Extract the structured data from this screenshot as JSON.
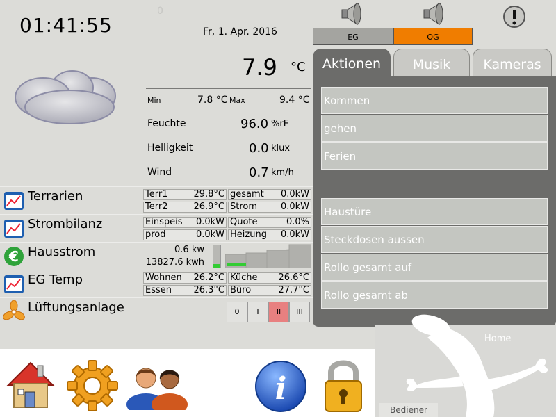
{
  "header": {
    "clock": "01:41:55",
    "date": "Fr, 1. Apr. 2016",
    "small_indicator": "0"
  },
  "weather": {
    "icon": "cloud-icon",
    "temperature": "7.9",
    "temperature_unit": "°C",
    "min_label": "Min",
    "min_value": "7.8 °C",
    "max_label": "Max",
    "max_value": "9.4 °C",
    "humidity_label": "Feuchte",
    "humidity_value": "96.0",
    "humidity_unit": "%rF",
    "brightness_label": "Helligkeit",
    "brightness_value": "0.0",
    "brightness_unit": "klux",
    "wind_label": "Wind",
    "wind_value": "0.7",
    "wind_unit": "km/h"
  },
  "sidebar": {
    "items": [
      {
        "label": "Terrarien",
        "icon": "chart-icon"
      },
      {
        "label": "Strombilanz",
        "icon": "chart-icon"
      },
      {
        "label": "Hausstrom",
        "icon": "euro-icon"
      },
      {
        "label": "EG Temp",
        "icon": "chart-icon"
      },
      {
        "label": "Lüftungsanlage",
        "icon": "fan-icon"
      }
    ]
  },
  "terrarien": {
    "terr1_label": "Terr1",
    "terr1_value": "29.8°C",
    "terr2_label": "Terr2",
    "terr2_value": "26.9°C",
    "gesamt_label": "gesamt",
    "gesamt_value": "0.0kW",
    "strom_label": "Strom",
    "strom_value": "0.0kW"
  },
  "strombilanz": {
    "einspeis_label": "Einspeis",
    "einspeis_value": "0.0kW",
    "prod_label": "prod",
    "prod_value": "0.0kW",
    "quote_label": "Quote",
    "quote_value": "0.0%",
    "heizung_label": "Heizung",
    "heizung_value": "0.0kW"
  },
  "hausstrom": {
    "power": "0.6 kw",
    "energy": "13827.6 kwh",
    "level_fraction": 0.15
  },
  "eg_temp": {
    "wohnen_label": "Wohnen",
    "wohnen_value": "26.2°C",
    "essen_label": "Essen",
    "essen_value": "26.3°C",
    "kueche_label": "Küche",
    "kueche_value": "26.6°C",
    "buero_label": "Büro",
    "buero_value": "27.7°C"
  },
  "lueftung": {
    "levels": [
      "0",
      "I",
      "II",
      "III"
    ],
    "active_level": "II"
  },
  "floors": {
    "eg_label": "EG",
    "og_label": "OG",
    "active": "OG"
  },
  "tabs": {
    "aktionen": "Aktionen",
    "musik": "Musik",
    "kameras": "Kameras"
  },
  "actions": {
    "group1": [
      "Kommen",
      "gehen",
      "Ferien"
    ],
    "group2": [
      "Haustüre",
      "Steckdosen aussen",
      "Rollo gesamt auf",
      "Rollo gesamt ab"
    ]
  },
  "bottom": {
    "home_label": "Home",
    "user_label": "Bediener"
  },
  "colors": {
    "accent_orange": "#f07d00",
    "tab_active": "#6c6c6a",
    "tab_inactive": "#c9c9c5",
    "panel_bg": "#6c6c6a",
    "button_bg": "#c4c6c1",
    "vent_active": "#e88080",
    "level_green": "#33cc33"
  }
}
